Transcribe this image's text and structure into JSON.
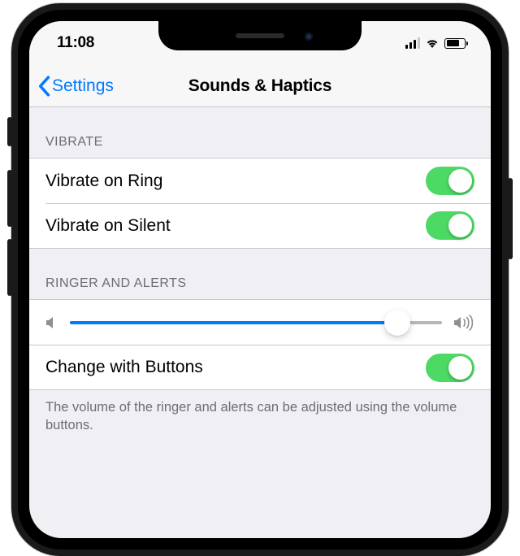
{
  "status": {
    "time": "11:08",
    "battery_pct": 75
  },
  "nav": {
    "back_label": "Settings",
    "title": "Sounds & Haptics"
  },
  "sections": {
    "vibrate": {
      "header": "Vibrate",
      "rows": [
        {
          "label": "Vibrate on Ring",
          "on": true
        },
        {
          "label": "Vibrate on Silent",
          "on": true
        }
      ]
    },
    "ringer": {
      "header": "Ringer and Alerts",
      "volume_pct": 88,
      "change_with_buttons": {
        "label": "Change with Buttons",
        "on": true
      },
      "footer": "The volume of the ringer and alerts can be adjusted using the volume buttons."
    }
  },
  "colors": {
    "tint": "#007aff",
    "toggle_on": "#4cd964",
    "section_bg": "#efeff4"
  }
}
